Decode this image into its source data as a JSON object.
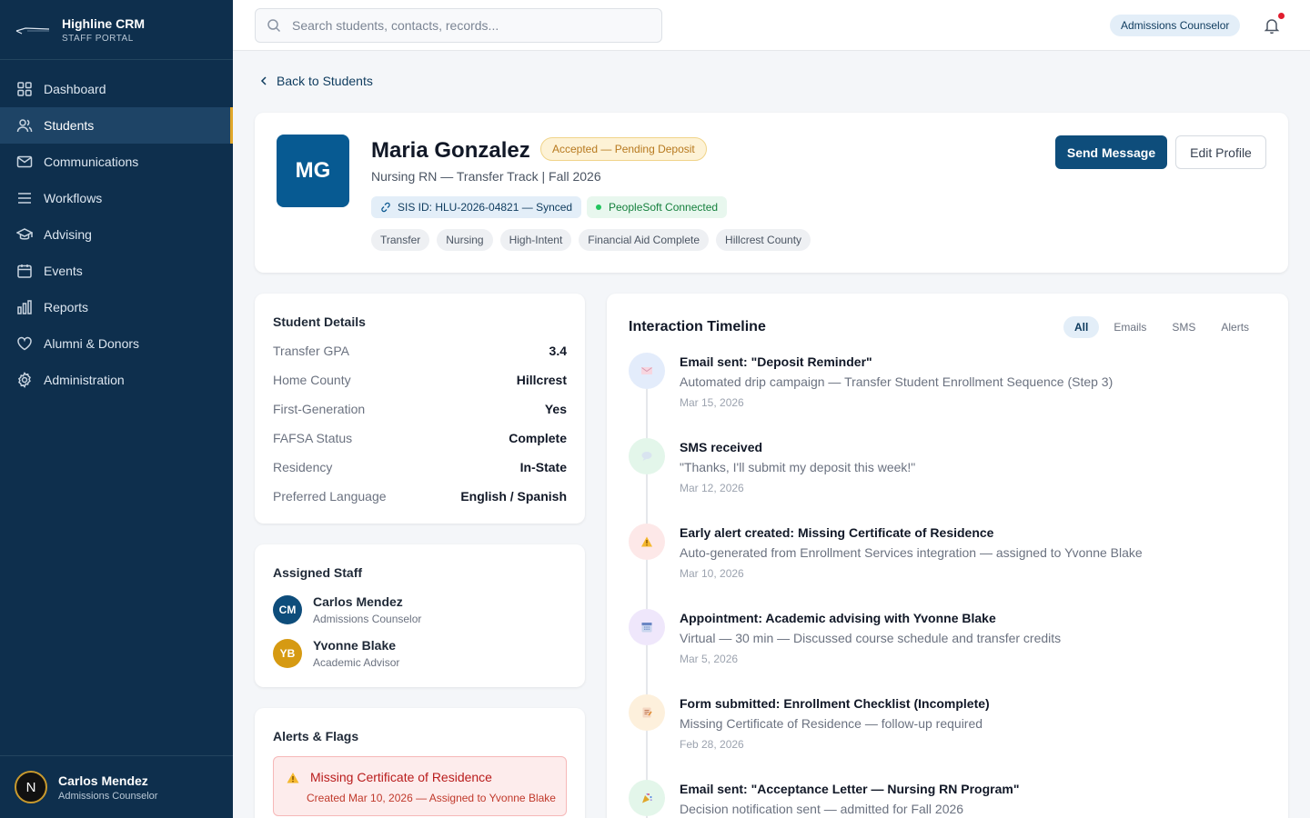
{
  "app": {
    "title": "Highline CRM",
    "subtitle": "STAFF PORTAL"
  },
  "nav": [
    {
      "label": "Dashboard",
      "icon": "grid-icon"
    },
    {
      "label": "Students",
      "icon": "users-icon",
      "active": true
    },
    {
      "label": "Communications",
      "icon": "mail-icon"
    },
    {
      "label": "Workflows",
      "icon": "list-icon"
    },
    {
      "label": "Advising",
      "icon": "graduation-cap-icon"
    },
    {
      "label": "Events",
      "icon": "calendar-icon"
    },
    {
      "label": "Reports",
      "icon": "bar-chart-icon"
    },
    {
      "label": "Alumni & Donors",
      "icon": "heart-icon"
    },
    {
      "label": "Administration",
      "icon": "gear-icon"
    }
  ],
  "current_user": {
    "initial": "N",
    "name": "Carlos Mendez",
    "role": "Admissions Counselor"
  },
  "topbar": {
    "search_placeholder": "Search students, contacts, records...",
    "role": "Admissions Counselor"
  },
  "back_link": "Back to Students",
  "student": {
    "initials": "MG",
    "name": "Maria Gonzalez",
    "status": "Accepted — Pending Deposit",
    "program": "Nursing RN — Transfer Track | Fall 2026",
    "sis": "SIS ID: HLU-2026-04821 — Synced",
    "peoplesoft": "PeopleSoft Connected",
    "tags": [
      "Transfer",
      "Nursing",
      "High-Intent",
      "Financial Aid Complete",
      "Hillcrest County"
    ]
  },
  "actions": {
    "send_message": "Send Message",
    "edit_profile": "Edit Profile"
  },
  "details": {
    "title": "Student Details",
    "rows": [
      {
        "label": "Transfer GPA",
        "value": "3.4"
      },
      {
        "label": "Home County",
        "value": "Hillcrest"
      },
      {
        "label": "First-Generation",
        "value": "Yes"
      },
      {
        "label": "FAFSA Status",
        "value": "Complete"
      },
      {
        "label": "Residency",
        "value": "In-State"
      },
      {
        "label": "Preferred Language",
        "value": "English / Spanish"
      }
    ]
  },
  "staff": {
    "title": "Assigned Staff",
    "members": [
      {
        "initials": "CM",
        "name": "Carlos Mendez",
        "role": "Admissions Counselor",
        "color": "#0e4d7b"
      },
      {
        "initials": "YB",
        "name": "Yvonne Blake",
        "role": "Academic Advisor",
        "color": "#d69a12"
      }
    ]
  },
  "alerts": {
    "title": "Alerts & Flags",
    "items": [
      {
        "title": "Missing Certificate of Residence",
        "meta": "Created Mar 10, 2026 — Assigned to Yvonne Blake"
      }
    ]
  },
  "timeline": {
    "title": "Interaction Timeline",
    "filters": [
      "All",
      "Emails",
      "SMS",
      "Alerts"
    ],
    "active_filter": "All",
    "items": [
      {
        "title": "Email sent: \"Deposit Reminder\"",
        "desc": "Automated drip campaign — Transfer Student Enrollment Sequence (Step 3)",
        "date": "Mar 15, 2026",
        "icon": "envelope-icon",
        "bg": "#e3ecfb"
      },
      {
        "title": "SMS received",
        "desc": "\"Thanks, I'll submit my deposit this week!\"",
        "date": "Mar 12, 2026",
        "icon": "speech-bubble-icon",
        "bg": "#e3f6ea"
      },
      {
        "title": "Early alert created: Missing Certificate of Residence",
        "desc": "Auto-generated from Enrollment Services integration — assigned to Yvonne Blake",
        "date": "Mar 10, 2026",
        "icon": "warning-icon",
        "bg": "#fde8e8"
      },
      {
        "title": "Appointment: Academic advising with Yvonne Blake",
        "desc": "Virtual — 30 min — Discussed course schedule and transfer credits",
        "date": "Mar 5, 2026",
        "icon": "calendar-icon",
        "bg": "#efe7fb"
      },
      {
        "title": "Form submitted: Enrollment Checklist (Incomplete)",
        "desc": "Missing Certificate of Residence — follow-up required",
        "date": "Feb 28, 2026",
        "icon": "memo-icon",
        "bg": "#fdf0dc"
      },
      {
        "title": "Email sent: \"Acceptance Letter — Nursing RN Program\"",
        "desc": "Decision notification sent — admitted for Fall 2026",
        "date": "",
        "icon": "party-popper-icon",
        "bg": "#e3f6ea"
      }
    ]
  },
  "colors": {
    "sidebar": "#0e2f4d",
    "primary": "#0e4d7b",
    "accent": "#e0a72a",
    "danger": "#b91c1c",
    "success": "#15803d"
  }
}
